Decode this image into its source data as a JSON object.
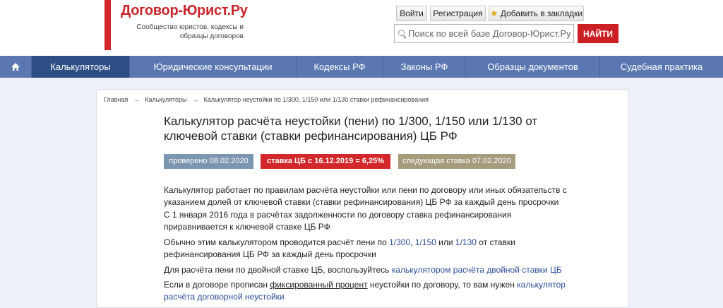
{
  "header": {
    "logo_title": "Договор-Юрист.Ру",
    "logo_subtitle": "Сообщество юристов, кодексы и образцы договоров",
    "login_label": "Войти",
    "register_label": "Регистрация",
    "bookmark_label": "Добавить в закладки",
    "search_placeholder": "Поиск по всей базе Договор-Юрист.Ру",
    "search_button": "НАЙТИ"
  },
  "nav": {
    "items": [
      "Калькуляторы",
      "Юридические консультации",
      "Кодексы РФ",
      "Законы РФ",
      "Образцы документов",
      "Судебная практика"
    ],
    "active": "Калькуляторы"
  },
  "breadcrumb": [
    "Главная",
    "Калькуляторы",
    "Калькулятор неустойки по 1/300, 1/150 или 1/130 ставки рефинансирования"
  ],
  "page": {
    "title": "Калькулятор расчёта неустойки (пени) по 1/300, 1/150 или 1/130 от ключевой ставки (ставки рефинансирования) ЦБ РФ",
    "badges": {
      "checked": "проверено 08.02.2020",
      "rate": "ставка ЦБ с 16.12.2019 = 6,25%",
      "next": "следующая ставка 07.02.2020"
    },
    "p1": "Калькулятор работает по правилам расчёта неустойки или пени по договору или иных обязательств с указанием долей от ключевой ставки (ставки рефинансирования) ЦБ РФ за каждый день просрочки",
    "p2": "С 1 января 2016 года в расчётах задолженности по договору ставка рефинансирования приравнивается к ключевой ставке ЦБ РФ",
    "p3_a": "Обычно этим калькулятором проводится расчёт пени по ",
    "p3_l1": "1/300",
    "p3_sep": ", ",
    "p3_l2": "1/150",
    "p3_or": " или ",
    "p3_l3": "1/130",
    "p3_b": " от ставки рефинансирования ЦБ РФ за каждый день просрочки",
    "p4_a": "Для расчёта пени по двойной ставке ЦБ, воспользуйтесь ",
    "p4_link": "калькулятором расчёта двойной ставки ЦБ",
    "p5_a": "Если в договоре прописан ",
    "p5_u": "фиксированный процент",
    "p5_b": " неустойки по договору, то вам нужен ",
    "p5_link": "калькулятор расчёта договорной неустойки"
  },
  "colors": {
    "brand_red": "#cc1f24",
    "nav_blue": "#5a77b1",
    "nav_active": "#2e4f86",
    "badge_checked": "#7c95b0",
    "badge_rate": "#d3282b",
    "badge_next": "#a59b7d",
    "link": "#2b4f9a"
  },
  "icons": {
    "home": "home-icon",
    "star": "star-icon",
    "search": "search-icon"
  }
}
